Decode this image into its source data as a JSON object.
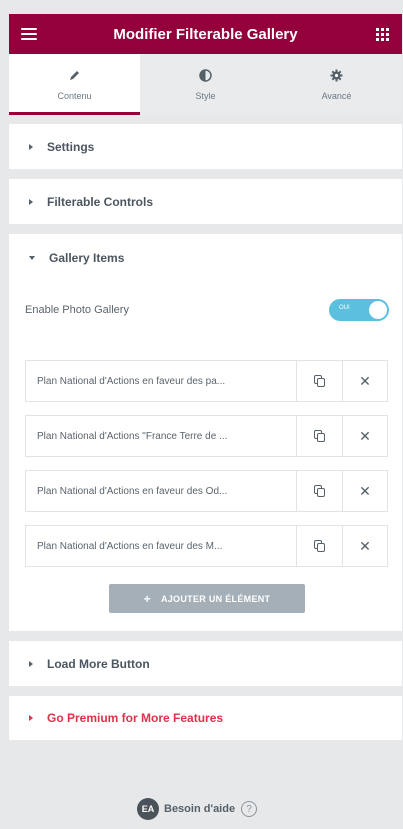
{
  "header": {
    "title": "Modifier Filterable Gallery"
  },
  "tabs": [
    {
      "label": "Contenu",
      "icon": "pencil-icon",
      "active": true
    },
    {
      "label": "Style",
      "icon": "contrast-icon",
      "active": false
    },
    {
      "label": "Avancé",
      "icon": "gear-icon",
      "active": false
    }
  ],
  "sections": {
    "settings": "Settings",
    "filterable_controls": "Filterable Controls",
    "gallery_items": "Gallery Items",
    "load_more": "Load More Button",
    "go_premium": "Go Premium for More Features"
  },
  "gallery": {
    "toggle_label": "Enable Photo Gallery",
    "toggle_state": "on",
    "toggle_text": "OUI",
    "items": [
      "Plan National d'Actions en faveur des pa...",
      "Plan National d'Actions \"France Terre de ...",
      "Plan National d'Actions en faveur des Od...",
      "Plan National d'Actions en faveur des M..."
    ],
    "add_button": "AJOUTER UN ÉLÉMENT"
  },
  "footer": {
    "logo_text": "EA",
    "help_text": "Besoin d'aide"
  },
  "colors": {
    "brand": "#93003c",
    "toggle_on": "#5bc0de",
    "premium": "#e0304a"
  }
}
